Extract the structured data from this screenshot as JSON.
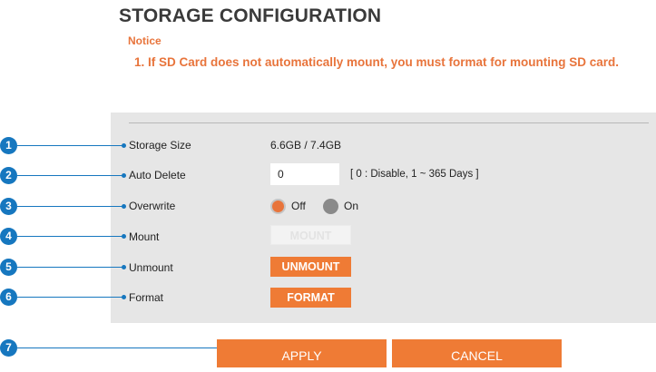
{
  "page": {
    "title": "STORAGE CONFIGURATION",
    "notice_title": "Notice",
    "notice_text": "1. If SD Card does not automatically mount, you must format for mounting SD card."
  },
  "markers": [
    "1",
    "2",
    "3",
    "4",
    "5",
    "6",
    "7"
  ],
  "rows": {
    "storage_size": {
      "label": "Storage Size",
      "value": "6.6GB / 7.4GB"
    },
    "auto_delete": {
      "label": "Auto Delete",
      "value": "0",
      "hint": "[ 0 : Disable, 1 ~ 365 Days ]"
    },
    "overwrite": {
      "label": "Overwrite",
      "option_off": "Off",
      "option_on": "On",
      "selected": "Off"
    },
    "mount": {
      "label": "Mount",
      "button": "MOUNT"
    },
    "unmount": {
      "label": "Unmount",
      "button": "UNMOUNT"
    },
    "format": {
      "label": "Format",
      "button": "FORMAT"
    }
  },
  "actions": {
    "apply": "APPLY",
    "cancel": "CANCEL"
  },
  "colors": {
    "accent": "#ef7b35",
    "notice": "#e8743b",
    "marker": "#1677bf",
    "panel": "#e6e6e6"
  }
}
